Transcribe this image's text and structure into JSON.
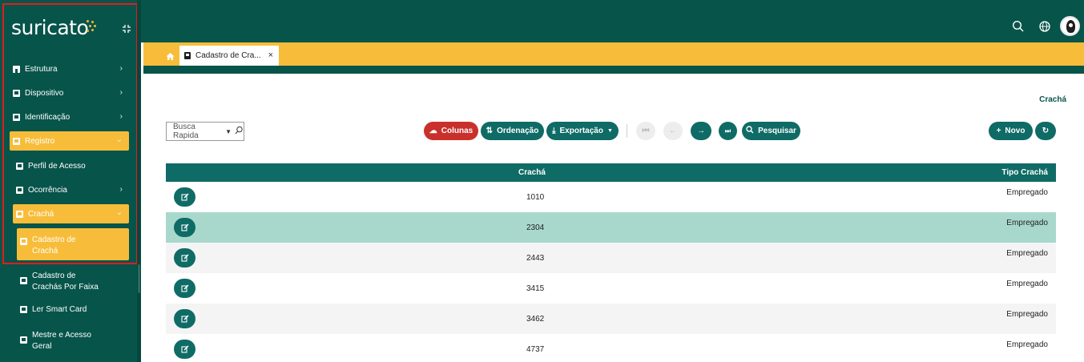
{
  "brand": {
    "name": "suricato",
    "accent": "#f6b93b",
    "primary": "#07544a",
    "button": "#0f6b66",
    "danger": "#c9302c"
  },
  "sidebar": {
    "items": [
      {
        "label": "Estrutura",
        "icon": "building-icon"
      },
      {
        "label": "Dispositivo",
        "icon": "device-icon"
      },
      {
        "label": "Identificação",
        "icon": "id-card-icon"
      },
      {
        "label": "Registro",
        "icon": "register-icon"
      },
      {
        "label": "Perfil de Acesso",
        "icon": "doc-icon"
      },
      {
        "label": "Ocorrência",
        "icon": "doc-icon"
      },
      {
        "label": "Crachá",
        "icon": "doc-icon"
      },
      {
        "label": "Cadastro de Crachá",
        "icon": "doc-icon"
      },
      {
        "label": "Cadastro de Crachás Por Faixa",
        "icon": "doc-icon"
      },
      {
        "label": "Ler Smart Card",
        "icon": "doc-icon"
      },
      {
        "label": "Mestre e Acesso Geral",
        "icon": "doc-icon"
      }
    ]
  },
  "tabs": [
    {
      "label": "Cadastro de Cra...",
      "close": "×"
    }
  ],
  "page": {
    "label": "Crachá"
  },
  "toolbar": {
    "search_placeholder": "Busca Rapida",
    "colunas": "Colunas",
    "ordenacao": "Ordenação",
    "exportacao": "Exportação",
    "pesquisar": "Pesquisar",
    "novo": "Novo"
  },
  "table": {
    "headers": [
      "Crachá",
      "Tipo Crachá"
    ],
    "rows": [
      {
        "cracha": "1010",
        "tipo": "Empregado"
      },
      {
        "cracha": "2304",
        "tipo": "Empregado"
      },
      {
        "cracha": "2443",
        "tipo": "Empregado"
      },
      {
        "cracha": "3415",
        "tipo": "Empregado"
      },
      {
        "cracha": "3462",
        "tipo": "Empregado"
      },
      {
        "cracha": "4737",
        "tipo": "Empregado"
      }
    ]
  }
}
